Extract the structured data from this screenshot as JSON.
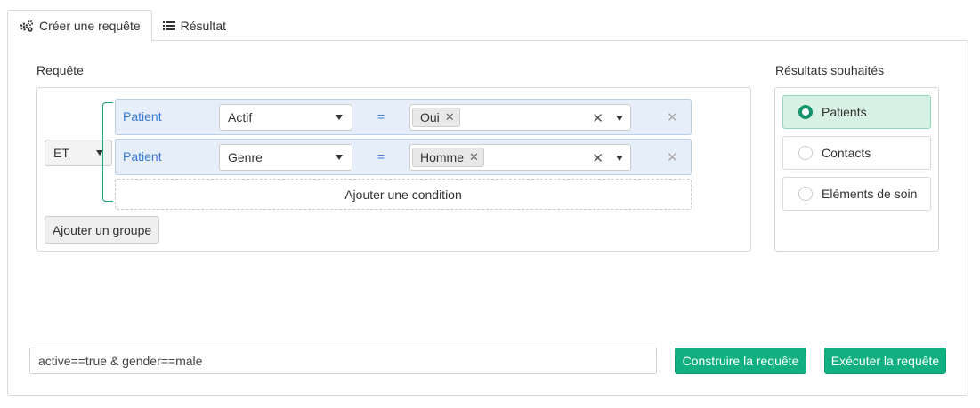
{
  "tabs": [
    {
      "label": "Créer une requête",
      "icon": "gears-icon",
      "active": true
    },
    {
      "label": "Résultat",
      "icon": "list-icon",
      "active": false
    }
  ],
  "query_builder": {
    "title": "Requête",
    "logic_operator": "ET",
    "conditions": [
      {
        "entity": "Patient",
        "field": "Actif",
        "operator": "=",
        "values": [
          "Oui"
        ]
      },
      {
        "entity": "Patient",
        "field": "Genre",
        "operator": "=",
        "values": [
          "Homme"
        ]
      }
    ],
    "add_condition_label": "Ajouter une condition",
    "add_group_label": "Ajouter un groupe"
  },
  "results": {
    "title": "Résultats souhaités",
    "options": [
      {
        "label": "Patients",
        "selected": true
      },
      {
        "label": "Contacts",
        "selected": false
      },
      {
        "label": "Eléments de soin",
        "selected": false
      }
    ]
  },
  "query_text": {
    "value": "active==true & gender==male"
  },
  "actions": {
    "build_label": "Construire la requête",
    "execute_label": "Exécuter la requête"
  },
  "colors": {
    "accent": "#12b081",
    "link": "#3a7bd5",
    "row_bg": "#e6eef9",
    "selected_bg": "#d7f2e5"
  }
}
